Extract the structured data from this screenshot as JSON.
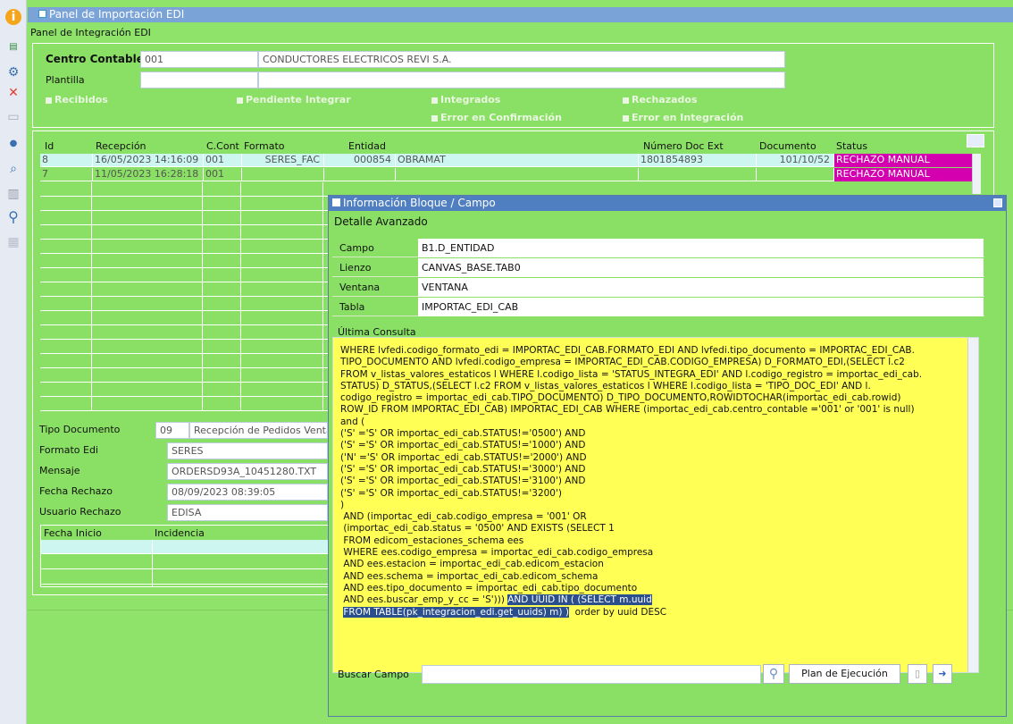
{
  "window": {
    "title": "Panel de Importación EDI",
    "panel_title": "Panel de Integración EDI"
  },
  "header": {
    "centro_label": "Centro Contable",
    "centro_code": "001",
    "centro_name": "CONDUCTORES ELECTRICOS REVI S.A.",
    "plantilla_label": "Plantilla",
    "plantilla_value": ""
  },
  "filters": {
    "recibidos": "Recibidos",
    "pendiente": "Pendiente Integrar",
    "integrados": "Integrados",
    "rechazados": "Rechazados",
    "error_confirmacion": "Error en Confirmación",
    "error_integracion": "Error en Integración"
  },
  "grid": {
    "columns": [
      "Id",
      "Recepción",
      "C.Cont",
      "Formato",
      "Entidad",
      "Número Doc Ext",
      "Documento",
      "Status"
    ],
    "rows": [
      {
        "id": "8",
        "recepcion": "16/05/2023 14:16:09",
        "ccont": "001",
        "formato": "SERES_FAC",
        "entidad_code": "000854",
        "entidad_name": "OBRAMAT",
        "numdoc": "1801854893",
        "documento": "101/10/52",
        "status": "RECHAZO MANUAL"
      },
      {
        "id": "7",
        "recepcion": "11/05/2023 16:28:18",
        "ccont": "001",
        "formato": "",
        "entidad_code": "",
        "entidad_name": "",
        "numdoc": "",
        "documento": "",
        "status": "RECHAZO MANUAL"
      }
    ]
  },
  "details": {
    "tipo_doc_label": "Tipo Documento",
    "tipo_doc_code": "09",
    "tipo_doc_desc": "Recepción de Pedidos Ventas",
    "formato_label": "Formato Edi",
    "formato_value": "SERES",
    "mensaje_label": "Mensaje",
    "mensaje_value": "ORDERSD93A_10451280.TXT",
    "fecha_rechazo_label": "Fecha Rechazo",
    "fecha_rechazo_value": "08/09/2023 08:39:05",
    "usuario_label": "Usuario Rechazo",
    "usuario_value": "EDISA"
  },
  "incidencias": {
    "col_fecha": "Fecha Inicio",
    "col_incidencia": "Incidencia"
  },
  "dialog": {
    "title": "Información Bloque / Campo",
    "subtitle": "Detalle Avanzado",
    "campo_label": "Campo",
    "campo_value": "B1.D_ENTIDAD",
    "lienzo_label": "Lienzo",
    "lienzo_value": "CANVAS_BASE.TAB0",
    "ventana_label": "Ventana",
    "ventana_value": "VENTANA",
    "tabla_label": "Tabla",
    "tabla_value": "IMPORTAC_EDI_CAB",
    "ultima_label": "Última Consulta",
    "sql_main": "WHERE lvfedi.codigo_formato_edi = IMPORTAC_EDI_CAB.FORMATO_EDI AND lvfedi.tipo_documento = IMPORTAC_EDI_CAB.\nTIPO_DOCUMENTO AND lvfedi.codigo_empresa = IMPORTAC_EDI_CAB.CODIGO_EMPRESA) D_FORMATO_EDI,(SELECT l.c2\nFROM v_listas_valores_estaticos l WHERE l.codigo_lista = 'STATUS_INTEGRA_EDI' AND l.codigo_registro = importac_edi_cab.\nSTATUS) D_STATUS,(SELECT l.c2 FROM v_listas_valores_estaticos l WHERE l.codigo_lista = 'TIPO_DOC_EDI' AND l.\ncodigo_registro = importac_edi_cab.TIPO_DOCUMENTO) D_TIPO_DOCUMENTO,ROWIDTOCHAR(importac_edi_cab.rowid)\nROW_ID FROM IMPORTAC_EDI_CAB) IMPORTAC_EDI_CAB WHERE (importac_edi_cab.centro_contable ='001' or '001' is null)\nand (\n('S' ='S' OR importac_edi_cab.STATUS!='0500') AND\n('S' ='S' OR importac_edi_cab.STATUS!='1000') AND\n('N' ='S' OR importac_edi_cab.STATUS!='2000') AND\n('S' ='S' OR importac_edi_cab.STATUS!='3000') AND\n('S' ='S' OR importac_edi_cab.STATUS!='3100') AND\n('S' ='S' OR importac_edi_cab.STATUS!='3200')\n)\n AND (importac_edi_cab.codigo_empresa = '001' OR\n (importac_edi_cab.status = '0500' AND EXISTS (SELECT 1\n FROM edicom_estaciones_schema ees\n WHERE ees.codigo_empresa = importac_edi_cab.codigo_empresa\n AND ees.estacion = importac_edi_cab.edicom_estacion\n AND ees.schema = importac_edi_cab.edicom_schema\n AND ees.tipo_documento = importac_edi_cab.tipo_documento\n AND ees.buscar_emp_y_cc = 'S'))) ",
    "sql_hl1": "AND UUID IN ( (SELECT m.uuid",
    "sql_nl": "\n ",
    "sql_hl2": "FROM TABLE(pk_integracion_edi.get_uuids) m) )",
    "sql_tail": "  order by uuid DESC",
    "buscar_label": "Buscar Campo",
    "buscar_value": "",
    "plan_button": "Plan de Ejecución"
  },
  "icons": {
    "search": "search-icon",
    "close": "close-icon",
    "exit": "exit-icon",
    "document": "document-icon"
  },
  "colors": {
    "background": "#8fe36a",
    "titlebar": "#7aa3d8",
    "status": "#d400b0",
    "sql_bg": "#ffff55",
    "highlight": "#2b4f8c"
  }
}
